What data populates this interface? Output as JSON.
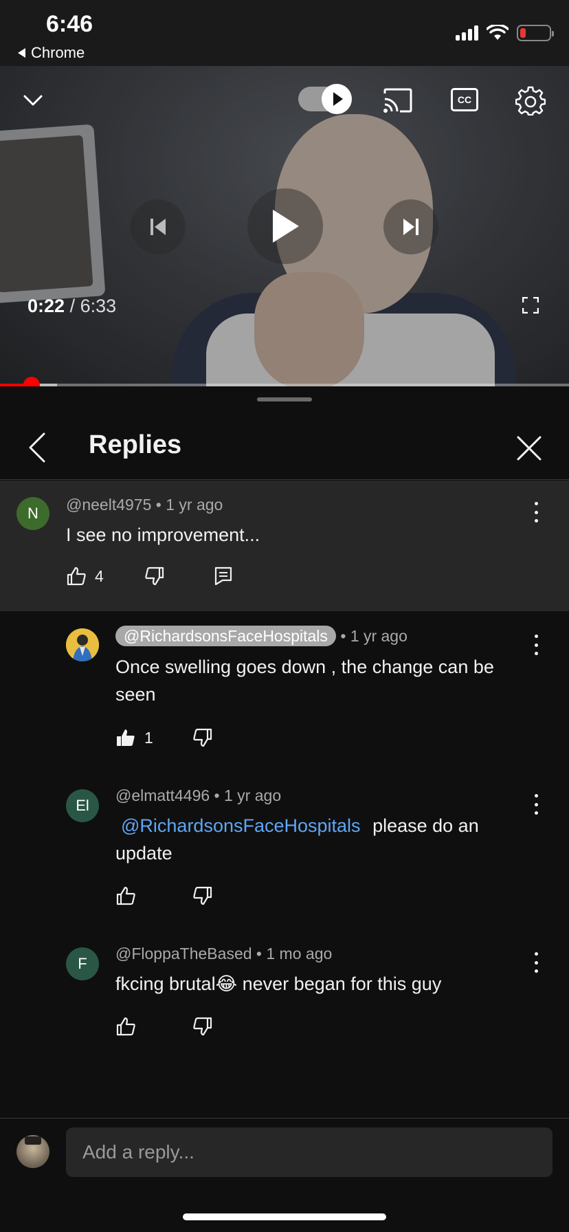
{
  "status_bar": {
    "time": "6:46",
    "back_label": "Chrome",
    "battery_color": "#e53935"
  },
  "player": {
    "current_time": "0:22",
    "separator": "/",
    "duration": "6:33",
    "progress_fraction": 0.056,
    "buffered_fraction": 0.1,
    "autoplay_on": true,
    "cc_label": "CC",
    "accent_color": "#ff0000",
    "icons": [
      "chevron-down-icon",
      "autoplay-toggle-icon",
      "cast-icon",
      "cc-icon",
      "gear-icon",
      "previous-icon",
      "play-icon",
      "next-icon",
      "fullscreen-icon"
    ]
  },
  "panel": {
    "title": "Replies"
  },
  "parent_comment": {
    "avatar_letter": "N",
    "avatar_color": "#3d6b2b",
    "author": "@neelt4975",
    "time": "1 yr ago",
    "text": "I see no improvement...",
    "likes": "4"
  },
  "replies": [
    {
      "author": "@RichardsonsFaceHospitals",
      "time": "1 yr ago",
      "text_line1": "Once swelling goes down , the change can be",
      "text_line2": "seen",
      "likes": "1",
      "is_creator": true,
      "liked": true
    },
    {
      "avatar_letter": "El",
      "avatar_color": "#2a5745",
      "author": "@elmatt4496",
      "time": "1 yr ago",
      "mention": "@RichardsonsFaceHospitals",
      "text_after_mention": "please do an",
      "text_line2": "update"
    },
    {
      "avatar_letter": "F",
      "avatar_color": "#2a5745",
      "author": "@FloppaTheBased",
      "time": "1 mo ago",
      "text_before_emoji": "fkcing brutal",
      "emoji": "😂",
      "text_after_emoji": " never began for this guy"
    }
  ],
  "reply_bar": {
    "placeholder": "Add a reply..."
  }
}
